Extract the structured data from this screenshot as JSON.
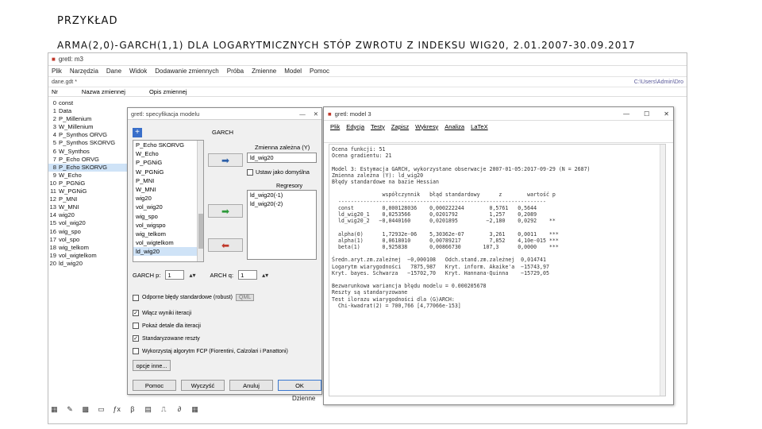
{
  "slide": {
    "label": "PRZYKŁAD",
    "title": "ARMA(2,0)-GARCH(1,1) DLA LOGARYTMICZNYCH STÓP ZWROTU Z INDEKSU WIG20, 2.01.2007-30.09.2017"
  },
  "main_window": {
    "title": "gretl: m3",
    "menu": [
      "Plik",
      "Narzędzia",
      "Dane",
      "Widok",
      "Dodawanie zmiennych",
      "Próba",
      "Zmienne",
      "Model",
      "Pomoc"
    ],
    "path": "dane.gdt *",
    "path_right": "C:\\Users\\Admin\\Dro",
    "col_headers": [
      "Nr",
      "Nazwa zmiennej",
      "Opis zmiennej"
    ],
    "variables": [
      {
        "num": "0",
        "name": "const"
      },
      {
        "num": "1",
        "name": "Data"
      },
      {
        "num": "2",
        "name": "P_Millenium"
      },
      {
        "num": "3",
        "name": "W_Millenium"
      },
      {
        "num": "4",
        "name": "P_Synthos ORVG"
      },
      {
        "num": "5",
        "name": "P_Synthos SKORVG"
      },
      {
        "num": "6",
        "name": "W_Synthos"
      },
      {
        "num": "7",
        "name": "P_Echo ORVG"
      },
      {
        "num": "8",
        "name": "P_Echo SKORVG"
      },
      {
        "num": "9",
        "name": "W_Echo"
      },
      {
        "num": "10",
        "name": "P_PGNiG"
      },
      {
        "num": "11",
        "name": "W_PGNiG"
      },
      {
        "num": "12",
        "name": "P_MNI"
      },
      {
        "num": "13",
        "name": "W_MNI"
      },
      {
        "num": "14",
        "name": "wig20"
      },
      {
        "num": "15",
        "name": "vol_wig20"
      },
      {
        "num": "16",
        "name": "wig_spo"
      },
      {
        "num": "17",
        "name": "vol_spo"
      },
      {
        "num": "18",
        "name": "wig_telkom"
      },
      {
        "num": "19",
        "name": "vol_wigtelkom"
      },
      {
        "num": "20",
        "name": "ld_wig20"
      }
    ],
    "selected_index": 8,
    "status": "Dzienne"
  },
  "spec_dialog": {
    "title": "gretl: specyfikacja modelu",
    "section": "GARCH",
    "list_items": [
      "P_Echo SKORVG",
      "W_Echo",
      "P_PGNiG",
      "W_PGNiG",
      "P_MNI",
      "W_MNI",
      "wig20",
      "vol_wig20",
      "wig_spo",
      "vol_wigspo",
      "wig_telkom",
      "vol_wigtelkom",
      "ld_wig20"
    ],
    "list_selected": 12,
    "dep_label": "Zmienna zależna (Y)",
    "dep_value": "ld_wig20",
    "default_label": "Ustaw jako domyślna",
    "regressors_label": "Regresory",
    "regressors": [
      "ld_wig20(-1)",
      "ld_wig20(-2)"
    ],
    "garch_p_label": "GARCH p:",
    "garch_p": "1",
    "arch_q_label": "ARCH q:",
    "arch_q": "1",
    "opt_robust": "Odporne błędy standardowe (robust)",
    "opt_cml": "QML",
    "opt_iter": "Włącz wyniki iteracji",
    "opt_details": "Pokaż detale dla iteracji",
    "opt_std": "Standaryzowane reszty",
    "opt_fcp": "Wykorzystaj algorytm FCP (Fiorentini, Calzolari i Panattoni)",
    "more_button": "opcje inne...",
    "btn_help": "Pomoc",
    "btn_clear": "Wyczyść",
    "btn_cancel": "Anuluj",
    "btn_ok": "OK"
  },
  "output_window": {
    "title": "gretl: model 3",
    "menu": [
      "Plik",
      "Edycja",
      "Testy",
      "Zapisz",
      "Wykresy",
      "Analiza",
      "LaTeX"
    ],
    "lines": [
      "Ocena funkcji: 51",
      "Ocena gradientu: 21",
      "",
      "Model 3: Estymacja GARCH, wykorzystane obserwacje 2007-01-05:2017-09-29 (N = 2687)",
      "Zmienna zależna (Y): ld_wig20",
      "Błędy standardowe na bazie Hessian",
      "",
      "                współczynnik   błąd standardowy      z        wartość p",
      "  ------------------------------------------------------------------",
      "  const         0,000128036    0,000222244        0,5761   0,5644",
      "  ld_wig20_1    0,0253566      0,0201792          1,257    0,2089",
      "  ld_wig20_2   −0,0440160      0,0201895         −2,180    0,0292    **",
      "",
      "  alpha(0)      1,72932e-06    5,30362e-07        3,261    0,0011    ***",
      "  alpha(1)      0,0618010      0,00789217         7,852    4,10e-015 ***",
      "  beta(1)       0,925838       0,00866730       107,3      0,0000    ***",
      "",
      "Średn.aryt.zm.zależnej  −0,000108   Odch.stand.zm.zależnej  0,014741",
      "Logarytm wiarygodności   7875,987   Kryt. inform. Akaike'a  −15743,97",
      "Kryt. bayes. Schwarza   −15702,70   Kryt. Hannana-Quinna    −15729,05",
      "",
      "Bezwarunkowa wariancja błędu modelu = 0.000205678",
      "Reszty są standaryzowane",
      "Test ilorazu wiarygodności dla (G)ARCH:",
      "  Chi-kwadrat(2) = 700,766 [4,77066e-153]"
    ]
  }
}
